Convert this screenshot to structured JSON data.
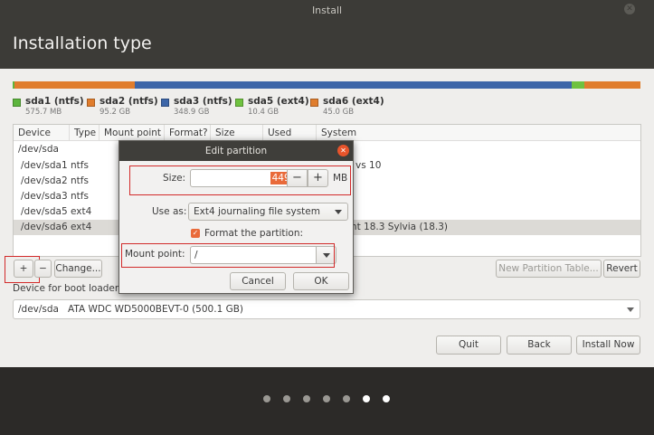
{
  "window": {
    "title": "Install"
  },
  "page": {
    "title": "Installation type"
  },
  "partition_bar": [
    {
      "name": "sda1 (ntfs)",
      "size": "575.7 MB",
      "color": "#5db53d"
    },
    {
      "name": "sda2 (ntfs)",
      "size": "95.2 GB",
      "color": "#e07d2d"
    },
    {
      "name": "sda3 (ntfs)",
      "size": "348.9 GB",
      "color": "#3d66a8"
    },
    {
      "name": "sda5 (ext4)",
      "size": "10.4 GB",
      "color": "#6fc23f"
    },
    {
      "name": "sda6 (ext4)",
      "size": "45.0 GB",
      "color": "#e07d2d"
    }
  ],
  "table": {
    "columns": [
      "Device",
      "Type",
      "Mount point",
      "Format?",
      "Size",
      "Used",
      "System"
    ],
    "rows": [
      {
        "device": "/dev/sda",
        "type": "",
        "system": ""
      },
      {
        "device": "/dev/sda1",
        "type": "ntfs",
        "system": "vs 10"
      },
      {
        "device": "/dev/sda2",
        "type": "ntfs",
        "system": ""
      },
      {
        "device": "/dev/sda3",
        "type": "ntfs",
        "system": ""
      },
      {
        "device": "/dev/sda5",
        "type": "ext4",
        "system": ""
      },
      {
        "device": "/dev/sda6",
        "type": "ext4",
        "system": "int 18.3 Sylvia (18.3)"
      }
    ],
    "selected_row": 5
  },
  "toolbar": {
    "add": "+",
    "remove": "−",
    "change": "Change...",
    "new_partition_table": "New Partition Table...",
    "revert": "Revert"
  },
  "boot_loader": {
    "label": "Device for boot loader",
    "device": "/dev/sda",
    "description": "ATA WDC WD5000BEVT-0 (500.1 GB)"
  },
  "buttons": {
    "quit": "Quit",
    "back": "Back",
    "install_now": "Install Now"
  },
  "dialog": {
    "title": "Edit partition",
    "size_label": "Size:",
    "size_value": "44997",
    "minus": "−",
    "plus": "+",
    "unit": "MB",
    "use_as_label": "Use as:",
    "use_as_value": "Ext4 journaling file system",
    "format_label": "Format the partition:",
    "format_checked": true,
    "mount_label": "Mount point:",
    "mount_value": "/",
    "cancel": "Cancel",
    "ok": "OK"
  },
  "progress": {
    "total_steps": 7,
    "current_step": 6
  }
}
